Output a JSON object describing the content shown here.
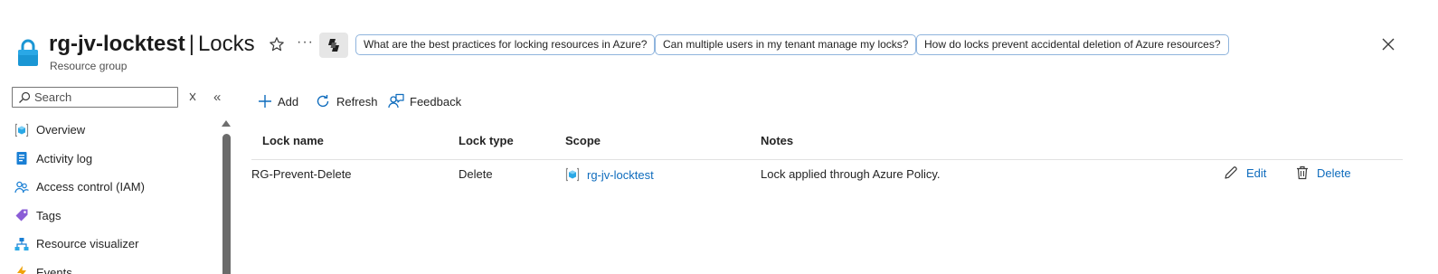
{
  "header": {
    "resource_name": "rg-jv-locktest",
    "separator": "|",
    "page_title": "Locks",
    "subtitle": "Resource group",
    "more_label": "···"
  },
  "suggestions": [
    "What are the best practices for locking resources in Azure?",
    "Can multiple users in my tenant manage my locks?",
    "How do locks prevent accidental deletion of Azure resources?"
  ],
  "sidebar": {
    "search_placeholder": "Search",
    "collapse_label": "«",
    "items": [
      {
        "label": "Overview",
        "icon": "resource-group-icon"
      },
      {
        "label": "Activity log",
        "icon": "activity-log-icon"
      },
      {
        "label": "Access control (IAM)",
        "icon": "people-icon"
      },
      {
        "label": "Tags",
        "icon": "tag-icon"
      },
      {
        "label": "Resource visualizer",
        "icon": "hierarchy-icon"
      },
      {
        "label": "Events",
        "icon": "lightning-icon"
      }
    ]
  },
  "toolbar": {
    "add_label": "Add",
    "refresh_label": "Refresh",
    "feedback_label": "Feedback"
  },
  "table": {
    "columns": [
      "Lock name",
      "Lock type",
      "Scope",
      "Notes"
    ],
    "rows": [
      {
        "lock_name": "RG-Prevent-Delete",
        "lock_type": "Delete",
        "scope": "rg-jv-locktest",
        "notes": "Lock applied through Azure Policy.",
        "edit_label": "Edit",
        "delete_label": "Delete"
      }
    ]
  },
  "colors": {
    "accent": "#0f6cbd",
    "chip_border": "#8fb4dd",
    "lock_icon": "#1a96d4"
  }
}
